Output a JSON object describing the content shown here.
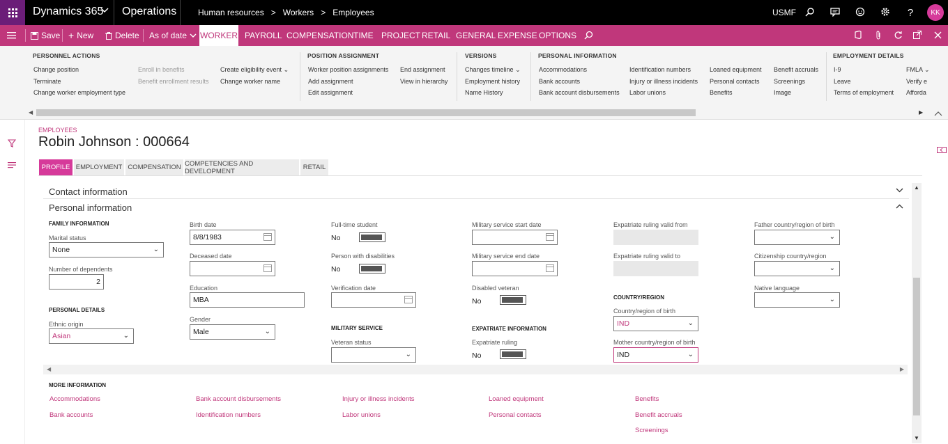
{
  "topbar": {
    "brand": "Dynamics 365",
    "module": "Operations",
    "breadcrumbs": [
      "Human resources",
      "Workers",
      "Employees"
    ],
    "company": "USMF",
    "avatar_initials": "KK",
    "icons": [
      "waffle-icon",
      "search-icon",
      "message-icon",
      "smiley-icon",
      "gear-icon",
      "help-icon"
    ]
  },
  "actionbar": {
    "save": "Save",
    "new": "New",
    "delete": "Delete",
    "as_of_date": "As of date",
    "tabs": [
      "WORKER",
      "PAYROLL",
      "COMPENSATION",
      "TIME",
      "PROJECT",
      "RETAIL",
      "GENERAL",
      "EXPENSE",
      "OPTIONS"
    ]
  },
  "ribbon": {
    "personnel_actions": {
      "title": "PERSONNEL ACTIONS",
      "col1": [
        "Change position",
        "Terminate",
        "Change worker employment type"
      ],
      "col2": [
        "Enroll in benefits",
        "Benefit enrollment results"
      ],
      "col3": [
        "Create eligibility event",
        "Change worker name"
      ]
    },
    "position_assignment": {
      "title": "POSITION ASSIGNMENT",
      "col1": [
        "Worker position assignments",
        "Add assignment",
        "Edit assignment"
      ],
      "col2": [
        "End assignment",
        "View in hierarchy"
      ]
    },
    "versions": {
      "title": "VERSIONS",
      "items": [
        "Changes timeline",
        "Employment history",
        "Name History"
      ]
    },
    "personal_information": {
      "title": "PERSONAL INFORMATION",
      "col1": [
        "Accommodations",
        "Bank accounts",
        "Bank account disbursements"
      ],
      "col2": [
        "Identification numbers",
        "Injury or illness incidents",
        "Labor unions"
      ],
      "col3": [
        "Loaned equipment",
        "Personal contacts",
        "Benefits"
      ],
      "col4": [
        "Benefit accruals",
        "Screenings",
        "Image"
      ]
    },
    "employment_details": {
      "title": "EMPLOYMENT DETAILS",
      "col1": [
        "I-9",
        "Leave",
        "Terms of employment"
      ],
      "col2": [
        "FMLA",
        "Verify e",
        "Afforda"
      ]
    }
  },
  "page": {
    "caption": "EMPLOYEES",
    "title": "Robin Johnson : 000664",
    "tabs": [
      "PROFILE",
      "EMPLOYMENT",
      "COMPENSATION",
      "COMPETENCIES AND DEVELOPMENT",
      "RETAIL"
    ]
  },
  "fasttabs": {
    "contact": "Contact information",
    "personal": "Personal information"
  },
  "form": {
    "family_info": "FAMILY INFORMATION",
    "marital_status_label": "Marital status",
    "marital_status": "None",
    "dependents_label": "Number of dependents",
    "dependents": "2",
    "personal_details": "PERSONAL DETAILS",
    "ethnic_origin_label": "Ethnic origin",
    "ethnic_origin": "Asian",
    "birth_date_label": "Birth date",
    "birth_date": "8/8/1983",
    "deceased_date_label": "Deceased date",
    "education_label": "Education",
    "education": "MBA",
    "gender_label": "Gender",
    "gender": "Male",
    "fulltime_student_label": "Full-time student",
    "fulltime_student": "No",
    "disabilities_label": "Person with disabilities",
    "disabilities": "No",
    "verification_date_label": "Verification date",
    "military_service": "MILITARY SERVICE",
    "veteran_status_label": "Veteran status",
    "mil_start_label": "Military service start date",
    "mil_end_label": "Military service end date",
    "disabled_veteran_label": "Disabled veteran",
    "disabled_veteran": "No",
    "expatriate_info": "EXPATRIATE INFORMATION",
    "expatriate_ruling_label": "Expatriate ruling",
    "expatriate_ruling": "No",
    "exp_from_label": "Expatriate ruling valid from",
    "exp_to_label": "Expatriate ruling valid to",
    "country_region": "COUNTRY/REGION",
    "birth_country_label": "Country/region of birth",
    "birth_country": "IND",
    "mother_country_label": "Mother country/region of birth",
    "mother_country": "IND",
    "father_country_label": "Father country/region of birth",
    "citizenship_label": "Citizenship country/region",
    "native_language_label": "Native language"
  },
  "more_info": {
    "title": "MORE INFORMATION",
    "links": [
      "Accommodations",
      "Bank accounts",
      "Bank account disbursements",
      "Identification numbers",
      "Injury or illness incidents",
      "Labor unions",
      "Loaned equipment",
      "Personal contacts",
      "Benefits",
      "Benefit accruals",
      "Screenings"
    ]
  },
  "colors": {
    "accent": "#c0377b",
    "topbar": "#000000",
    "waffle": "#6b1d78"
  }
}
